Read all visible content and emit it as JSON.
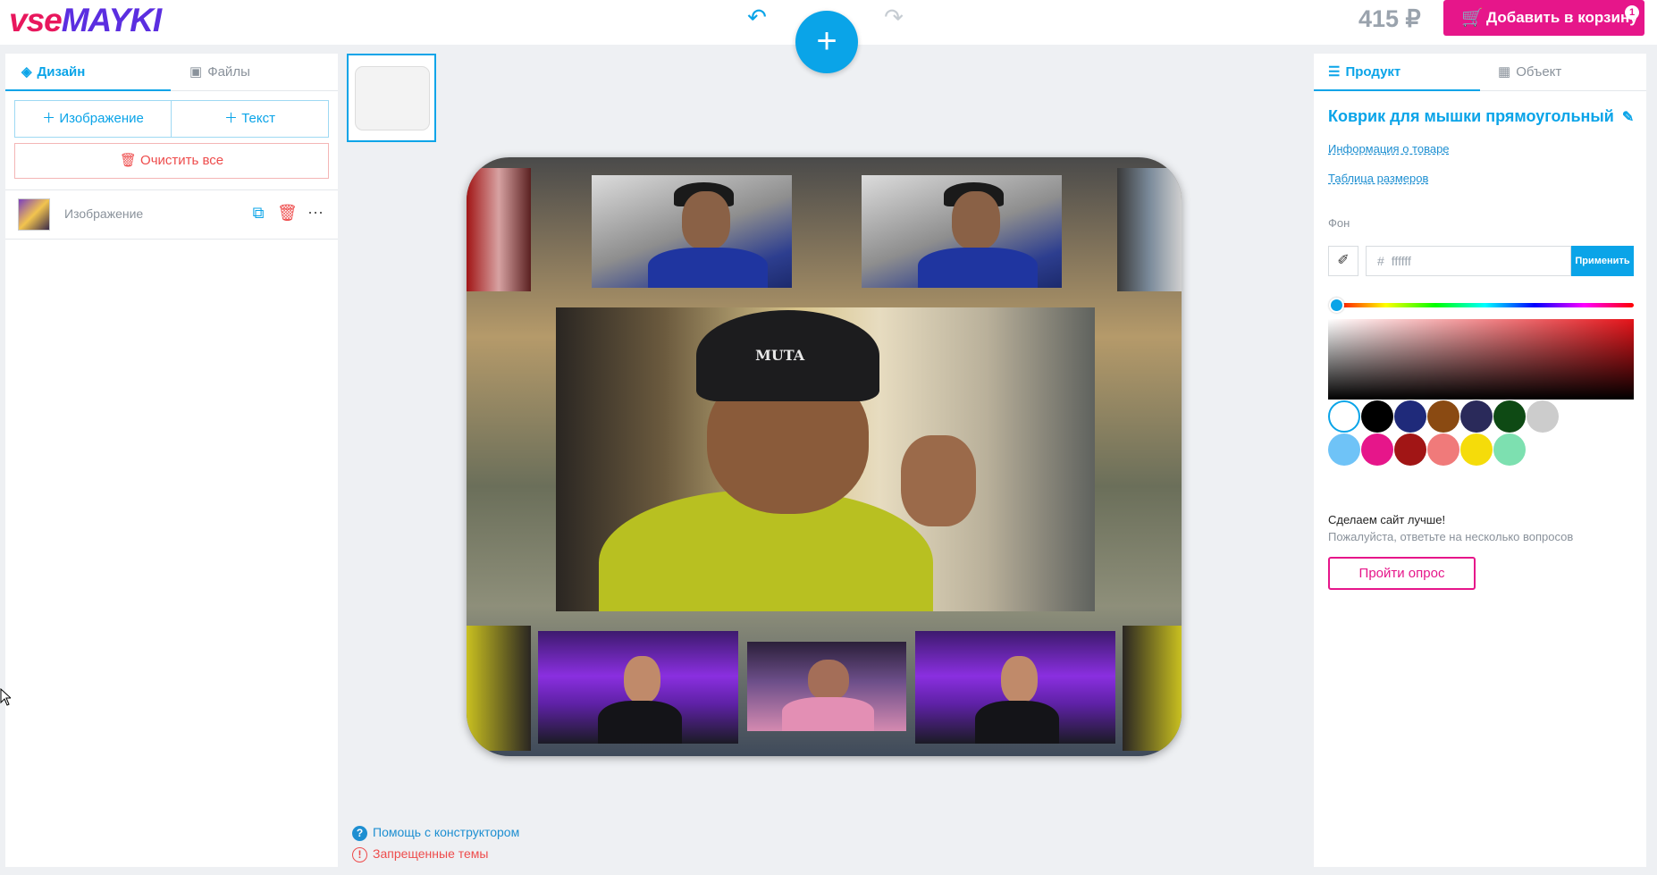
{
  "header": {
    "logo_part1": "vse",
    "logo_part2": "MAYKI",
    "undo_icon": "undo-icon",
    "redo_icon": "redo-icon",
    "add_label": "+",
    "price": "415 ₽",
    "cart_label": "Добавить в корзину",
    "cart_count": "1",
    "accent_color": "#0aa4e8",
    "brand_pink": "#e6168a"
  },
  "left_panel": {
    "tabs": [
      {
        "label": "Дизайн",
        "icon": "layers-icon",
        "active": true
      },
      {
        "label": "Файлы",
        "icon": "images-icon",
        "active": false
      }
    ],
    "add_image_label": "Изображение",
    "add_text_label": "Текст",
    "clear_label": "Очистить все",
    "layers": [
      {
        "label": "Изображение",
        "thumb": "collage-thumbnail"
      }
    ]
  },
  "center": {
    "help_label": "Помощь с конструктором",
    "forbidden_label": "Запрещенные темы",
    "cap_text": "MUTA"
  },
  "right_panel": {
    "tabs": [
      {
        "label": "Продукт",
        "icon": "sliders-icon",
        "active": true
      },
      {
        "label": "Объект",
        "icon": "grid-icon",
        "active": false
      }
    ],
    "product_title": "Коврик для мышки прямоугольный",
    "info_link": "Информация о товаре",
    "size_link": "Таблица размеров",
    "bg_label": "Фон",
    "hex_placeholder": "ffffff",
    "hex_hash": "#",
    "apply_label": "Применить",
    "swatches": [
      "#ffffff",
      "#000000",
      "#1f2a7a",
      "#8a4a12",
      "#2a2a5a",
      "#0e4a14",
      "#cccccc",
      "#6fc3f7",
      "#e6168a",
      "#a11515",
      "#f07a7a",
      "#f5dc0a",
      "#7de0b0"
    ],
    "survey_title": "Сделаем сайт лучше!",
    "survey_sub": "Пожалуйста, ответьте на несколько вопросов",
    "survey_btn": "Пройти опрос"
  }
}
